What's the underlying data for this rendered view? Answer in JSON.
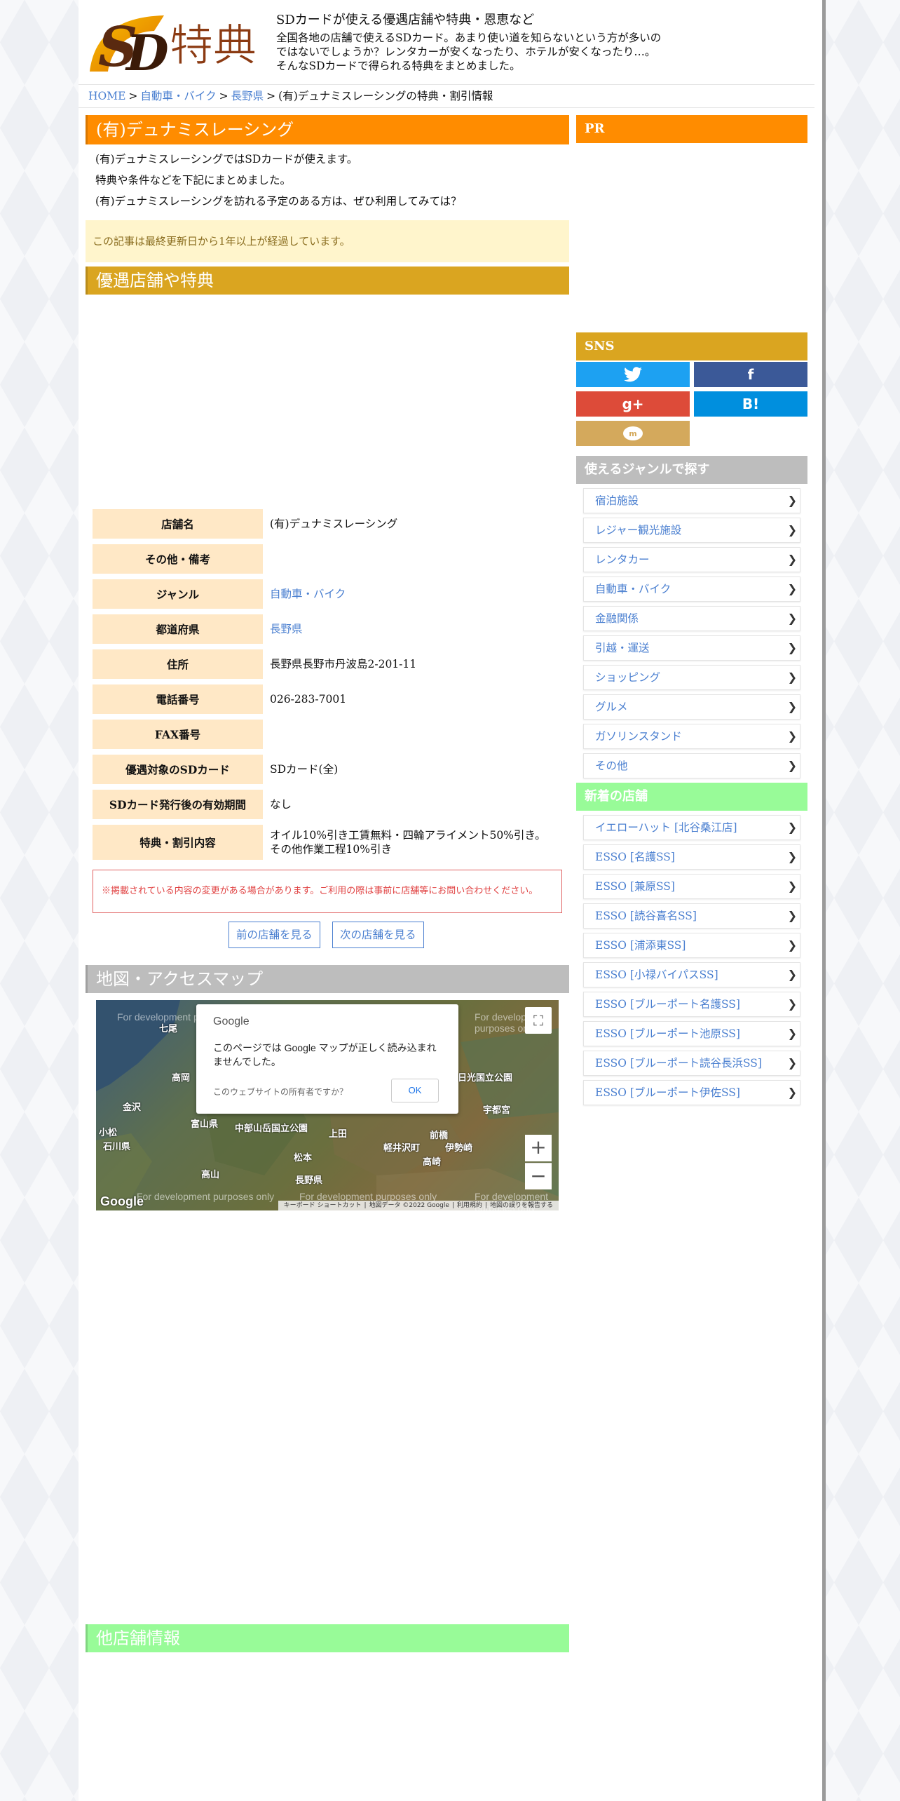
{
  "header": {
    "logo_text": "SD特典",
    "site_title": "SDカードが使える優遇店舗や特典・恩恵など",
    "site_desc": [
      "全国各地の店舗で使えるSDカード。あまり使い道を知らないという方が多いの",
      "ではないでしょうか？レンタカーが安くなったり、ホテルが安くなったり…。",
      "そんなSDカードで得られる特典をまとめました。"
    ]
  },
  "breadcrumb": {
    "home": "HOME",
    "cat": "自動車・バイク",
    "pref": "長野県",
    "current": "(有)デュナミスレーシングの特典・割引情報",
    "sep": ">"
  },
  "main": {
    "title": "(有)デュナミスレーシング",
    "intro": [
      "(有)デュナミスレーシングではSDカードが使えます。",
      "特典や条件などを下記にまとめました。",
      "(有)デュナミスレーシングを訪れる予定のある方は、ぜひ利用してみては？"
    ],
    "notice": "この記事は最終更新日から1年以上が経過しています。",
    "section_benefits": "優遇店舗や特典",
    "table": [
      {
        "label": "店舗名",
        "value": "(有)デュナミスレーシング"
      },
      {
        "label": "その他・備考",
        "value": ""
      },
      {
        "label": "ジャンル",
        "value": "自動車・バイク"
      },
      {
        "label": "都道府県",
        "value": "長野県"
      },
      {
        "label": "住所",
        "value": "長野県長野市丹波島2-201-11"
      },
      {
        "label": "電話番号",
        "value": "026-283-7001"
      },
      {
        "label": "FAX番号",
        "value": ""
      },
      {
        "label": "優遇対象のSDカード",
        "value": "SDカード(全)"
      },
      {
        "label": "SDカード発行後の有効期間",
        "value": "なし"
      },
      {
        "label": "特典・割引内容",
        "value": "オイル10%引き工賃無料・四輪アライメント50%引き。",
        "value2": "その他作業工程10%引き"
      }
    ],
    "warning": "※掲載されている内容の変更がある場合があります。ご利用の際は事前に店舗等にお問い合わせください。",
    "prev_button": "前の店舗を見る",
    "next_button": "次の店舗を見る",
    "section_map": "地図・アクセスマップ",
    "section_other": "他店舗情報"
  },
  "map": {
    "dialog_brand": "Google",
    "dialog_message": "このページでは Google マップが正しく読み込まれませんでした。",
    "dialog_owner": "このウェブサイトの所有者ですか？",
    "dialog_ok": "OK",
    "dev_text": "For development purposes only",
    "places": [
      "金沢",
      "石川県",
      "富山県",
      "高山",
      "松本",
      "長野県",
      "前橋",
      "高崎",
      "宇都宮",
      "日光国立公園",
      "中部山岳国立公園",
      "軽井沢町",
      "伊勢崎",
      "上田",
      "七尾",
      "高岡",
      "小松"
    ],
    "logo": "Google",
    "attribution": [
      "キーボード ショートカット",
      "地図データ ©2022 Google",
      "利用規約",
      "地図の誤りを報告する"
    ]
  },
  "sidebar": {
    "pr": "PR",
    "sns": "SNS",
    "genre_title": "使えるジャンルで探す",
    "genres": [
      "宿泊施設",
      "レジャー観光施設",
      "レンタカー",
      "自動車・バイク",
      "金融関係",
      "引越・運送",
      "ショッピング",
      "グルメ",
      "ガソリンスタンド",
      "その他"
    ],
    "new_title": "新着の店舗",
    "new_shops": [
      "イエローハット [北谷桑江店]",
      "ESSO [名護SS]",
      "ESSO [兼原SS]",
      "ESSO [読谷喜名SS]",
      "ESSO [浦添東SS]",
      "ESSO [小禄バイパスSS]",
      "ESSO [ブルーポート名護SS]",
      "ESSO [ブルーポート池原SS]",
      "ESSO [ブルーポート読谷長浜SS]",
      "ESSO [ブルーポート伊佐SS]"
    ]
  },
  "colors": {
    "orange": "#ff8c00",
    "gold": "#daa520",
    "gray": "#bdbdbd",
    "green": "#98fb98",
    "link": "#4a7fd0"
  }
}
